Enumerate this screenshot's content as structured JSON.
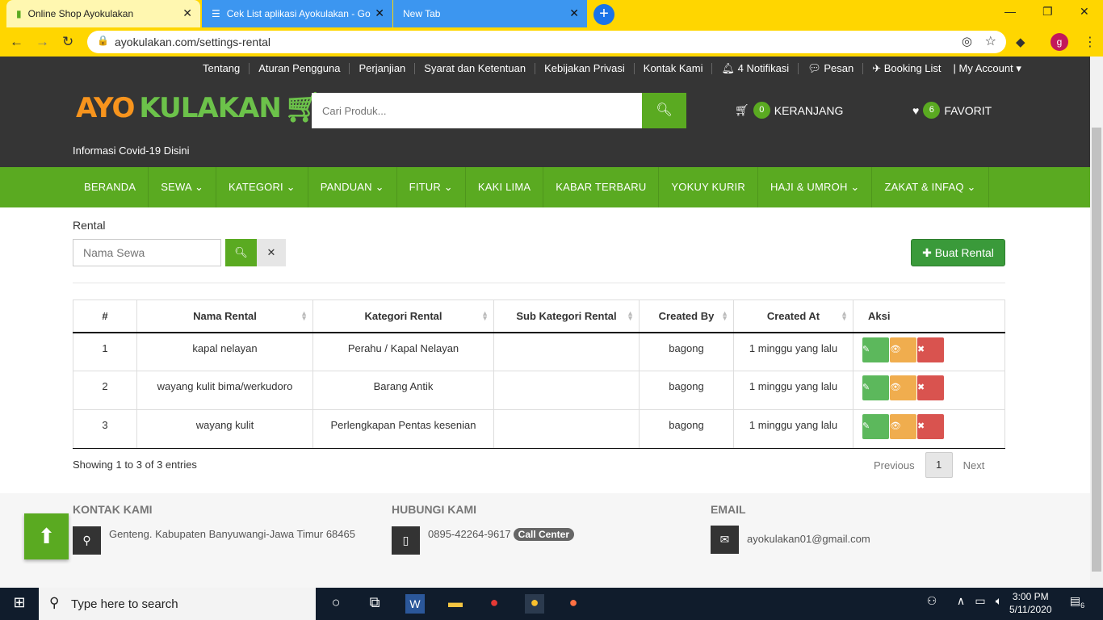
{
  "browser": {
    "tabs": [
      {
        "title": "Online Shop Ayokulakan"
      },
      {
        "title": "Cek List aplikasi Ayokulakan - Go"
      },
      {
        "title": "New Tab"
      }
    ],
    "url": "ayokulakan.com/settings-rental",
    "profile_initial": "g"
  },
  "header": {
    "top_links": [
      "Tentang",
      "Aturan Pengguna",
      "Perjanjian",
      "Syarat dan Ketentuan",
      "Kebijakan Privasi",
      "Kontak Kami",
      "4 Notifikasi",
      "Pesan",
      "Booking List",
      "| My Account"
    ],
    "logo_text_1": "AYO",
    "logo_text_2": "KULAKAN",
    "search_placeholder": "Cari Produk...",
    "cart_count": "0",
    "cart_label": "KERANJANG",
    "fav_count": "6",
    "fav_label": "FAVORIT",
    "covid_link": "Informasi Covid-19 Disini"
  },
  "menu": [
    "BERANDA",
    "SEWA ⌄",
    "KATEGORI ⌄",
    "PANDUAN ⌄",
    "FITUR ⌄",
    "KAKI LIMA",
    "KABAR TERBARU",
    "YOKUY KURIR",
    "HAJI & UMROH ⌄",
    "ZAKAT & INFAQ ⌄"
  ],
  "content": {
    "section_label": "Rental",
    "filter_placeholder": "Nama Sewa",
    "create_button": "Buat Rental",
    "columns": [
      "#",
      "Nama Rental",
      "Kategori Rental",
      "Sub Kategori Rental",
      "Created By",
      "Created At",
      "Aksi"
    ],
    "rows": [
      [
        "1",
        "kapal nelayan",
        "Perahu / Kapal Nelayan",
        "",
        "bagong",
        "1 minggu yang lalu"
      ],
      [
        "2",
        "wayang kulit bima/werkudoro",
        "Barang Antik",
        "",
        "bagong",
        "1 minggu yang lalu"
      ],
      [
        "3",
        "wayang kulit",
        "Perlengkapan Pentas kesenian",
        "",
        "bagong",
        "1 minggu yang lalu"
      ]
    ],
    "showing": "Showing 1 to 3 of 3 entries",
    "pager": {
      "prev": "Previous",
      "current": "1",
      "next": "Next"
    }
  },
  "footer": {
    "kontak_title": "KONTAK KAMI",
    "kontak_text": "Genteng. Kabupaten Banyuwangi-Jawa Timur 68465",
    "hubungi_title": "HUBUNGI KAMI",
    "hubungi_text": "0895-42264-9617",
    "call_center": "Call Center",
    "email_title": "EMAIL",
    "email_text": "ayokulakan01@gmail.com"
  },
  "taskbar": {
    "search_placeholder": "Type here to search",
    "time": "3:00 PM",
    "date": "5/11/2020",
    "notif_count": "6"
  },
  "colors": {
    "brand_green": "#5aaa21",
    "header_dark": "#353535",
    "chrome_yellow": "#ffd600",
    "tab_blue": "#3c96f0"
  }
}
